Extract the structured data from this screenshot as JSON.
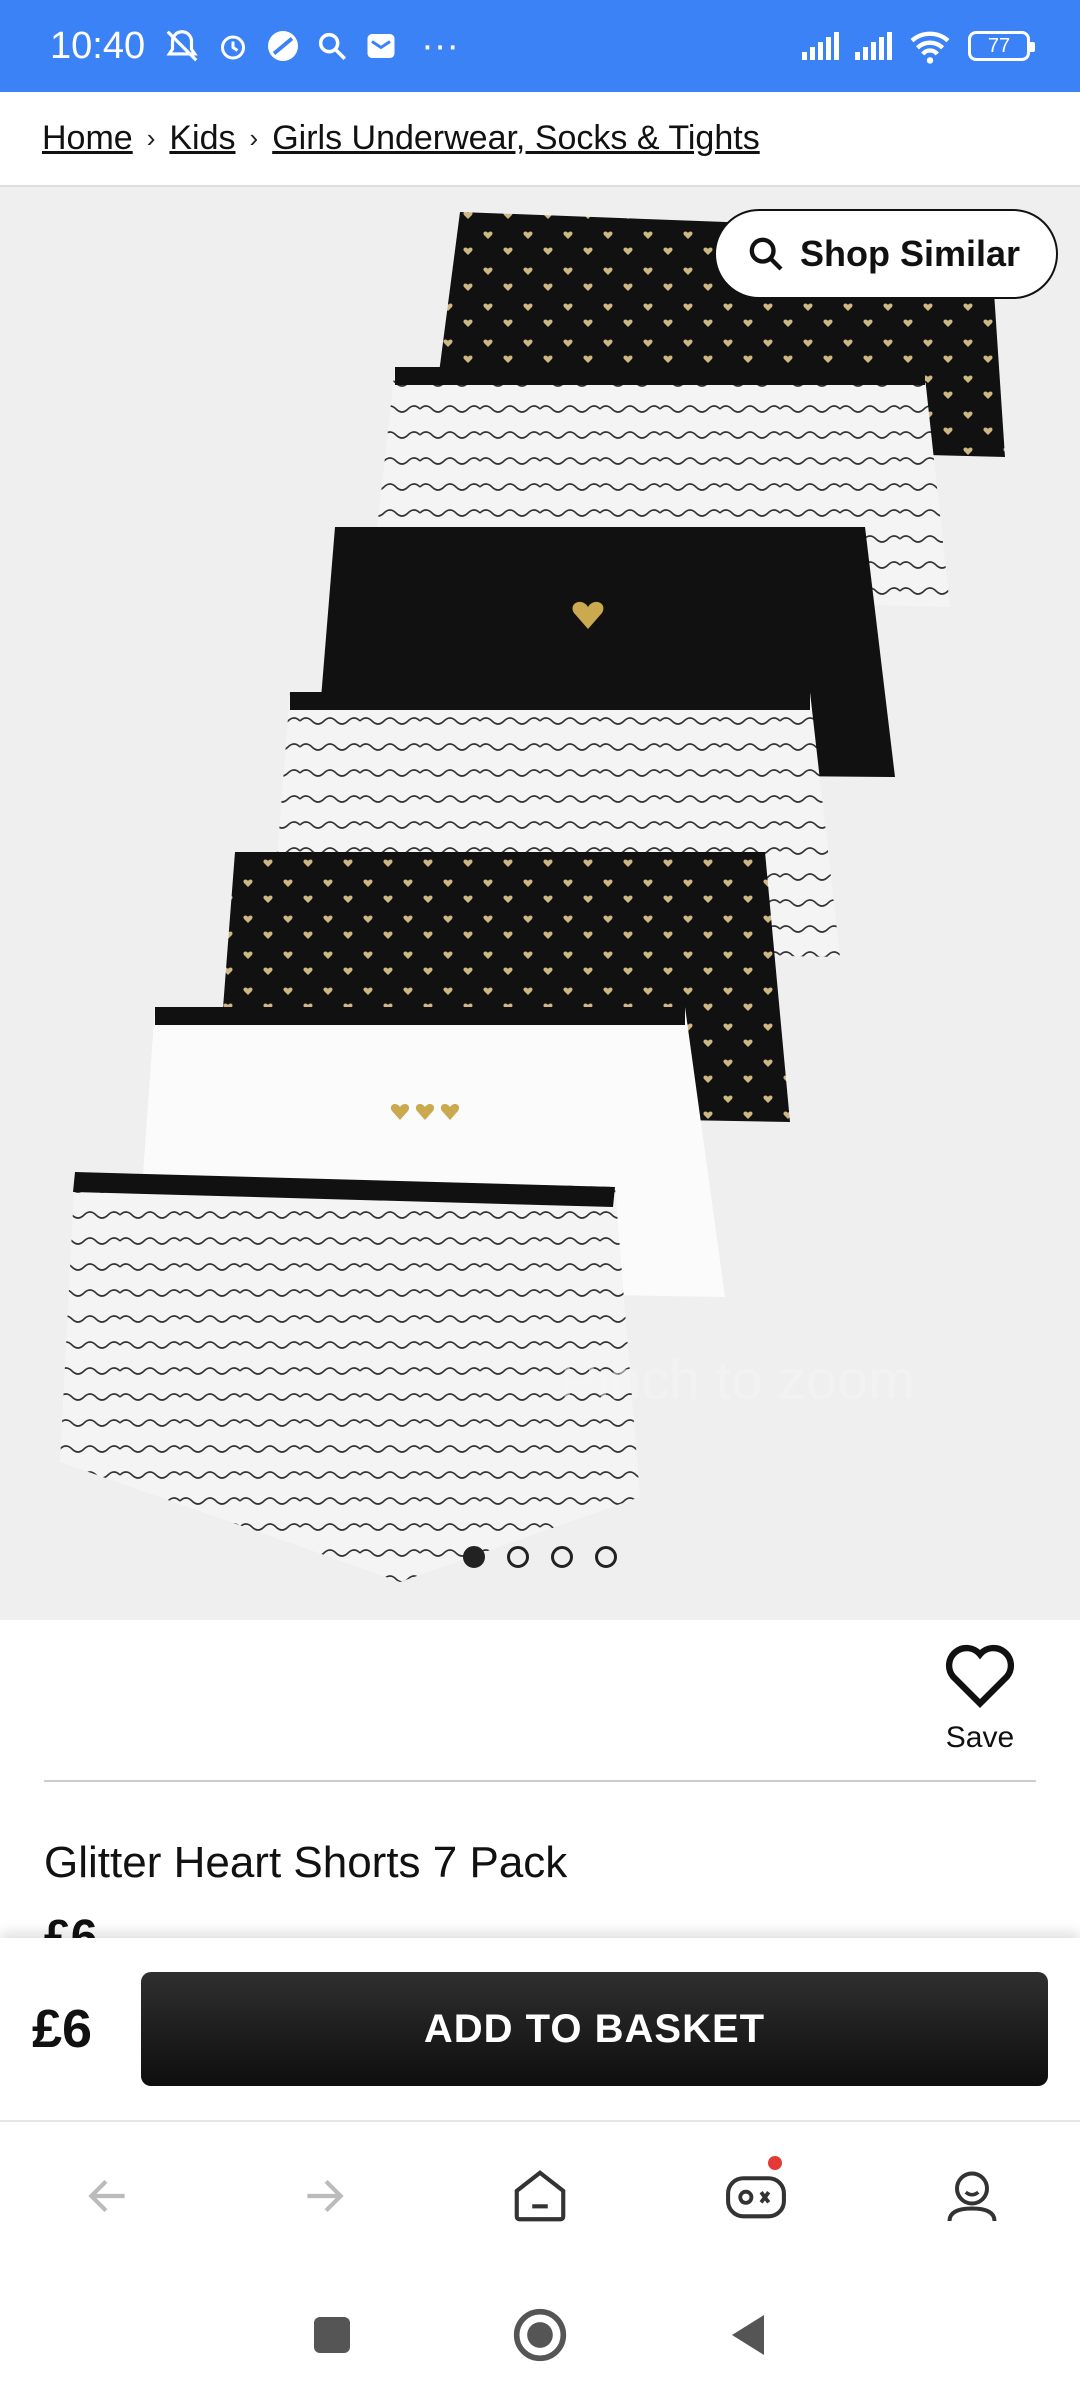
{
  "status": {
    "time": "10:40",
    "battery": "77",
    "more": "···"
  },
  "breadcrumb": {
    "items": [
      "Home",
      "Kids",
      "Girls Underwear, Socks & Tights"
    ],
    "sep": "›"
  },
  "gallery": {
    "shop_similar": "Shop Similar",
    "zoom_hint": "Pinch to zoom",
    "page_count": 4,
    "active_index": 0
  },
  "product": {
    "save_label": "Save",
    "title": "Glitter Heart Shorts 7 Pack",
    "price": "£6"
  },
  "buybar": {
    "price": "£6",
    "add_label": "ADD TO BASKET"
  },
  "colors": {
    "statusbar": "#3b82f6",
    "button": "#1a1a1a",
    "badge": "#e53935"
  }
}
